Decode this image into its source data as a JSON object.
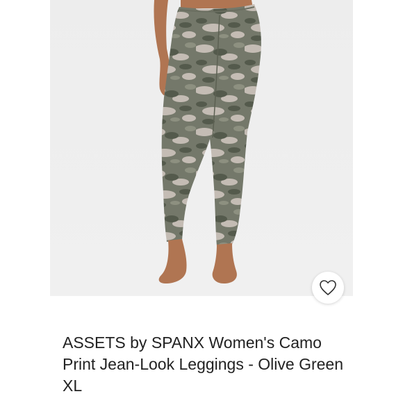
{
  "product": {
    "title": "ASSETS by SPANX Women's Camo Print Jean-Look Leggings - Olive Green XL",
    "image_icon": "product-photo-leggings",
    "favorite_icon": "heart-outline-icon"
  },
  "colors": {
    "photo_background": "#eeeeee",
    "camo_base": "#74786a",
    "camo_light": "#c4bcb4",
    "camo_dark": "#545a4c",
    "skin": "#b07552",
    "title_text": "#222222"
  }
}
